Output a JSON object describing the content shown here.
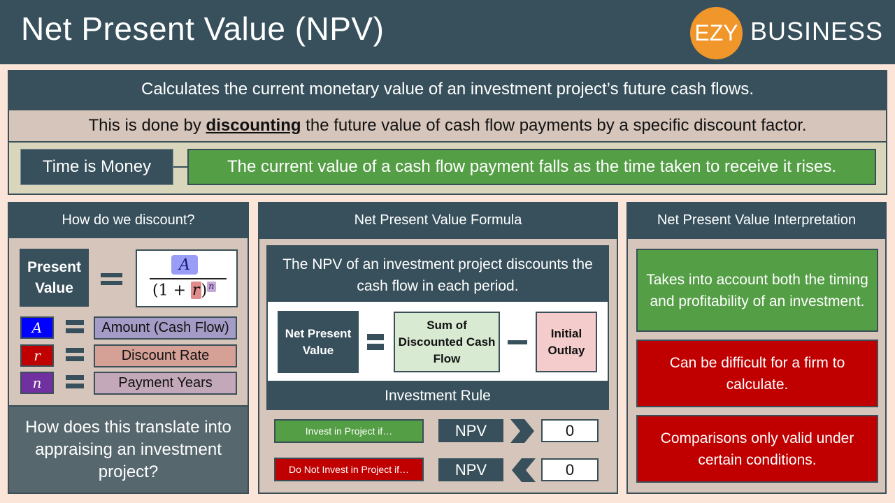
{
  "header": {
    "title": "Net Present Value (NPV)",
    "logo": {
      "circle_text": "EZY",
      "text": "BUSINESS",
      "circle_color": "#f0962a"
    }
  },
  "overview": {
    "definition": "Calculates the current monetary value of an investment project’s future cash flows.",
    "discount_prefix": "This is done by ",
    "discount_keyword": "discounting",
    "discount_suffix": " the future value of cash flow payments by a specific discount factor.",
    "time_is_money_label": "Time is Money",
    "time_is_money_text": "The current value of a cash flow payment falls as the time taken to receive it rises."
  },
  "discount_panel": {
    "heading": "How do we discount?",
    "present_value_line1": "Present",
    "present_value_line2": "Value",
    "formula": {
      "numerator": "A",
      "denominator_prefix": "(1 + ",
      "denominator_rate": "r",
      "denominator_close": ")",
      "exponent": "n"
    },
    "variables": [
      {
        "symbol": "A",
        "label": "Amount (Cash Flow)",
        "symbol_color": "#0000ff",
        "label_color": "#a49bc6"
      },
      {
        "symbol": "r",
        "label": "Discount Rate",
        "symbol_color": "#c00000",
        "label_color": "#d5a096"
      },
      {
        "symbol": "n",
        "label": "Payment Years",
        "symbol_color": "#7030a0",
        "label_color": "#c2a8b8"
      }
    ],
    "question": "How does this translate into appraising an investment project?"
  },
  "formula_panel": {
    "heading": "Net Present Value Formula",
    "description": "The NPV of an investment project discounts the cash flow in each period.",
    "npv_term": "Net Present Value",
    "sum_term": "Sum of Discounted Cash Flow",
    "outlay_term": "Initial Outlay",
    "rule_heading": "Investment Rule",
    "rules": [
      {
        "label": "Invest in Project if…",
        "metric": "NPV",
        "operator": "greater-than",
        "value": "0",
        "color": "#549e45"
      },
      {
        "label": "Do Not Invest in Project if…",
        "metric": "NPV",
        "operator": "less-than",
        "value": "0",
        "color": "#c00000"
      }
    ]
  },
  "interpretation_panel": {
    "heading": "Net Present Value Interpretation",
    "points": [
      {
        "text": "Takes into account both the timing and profitability of an investment.",
        "type": "advantage",
        "color": "#549e45"
      },
      {
        "text": "Can be difficult for a firm to calculate.",
        "type": "disadvantage",
        "color": "#c00000"
      },
      {
        "text": "Comparisons only valid under certain conditions.",
        "type": "disadvantage",
        "color": "#c00000"
      }
    ]
  }
}
